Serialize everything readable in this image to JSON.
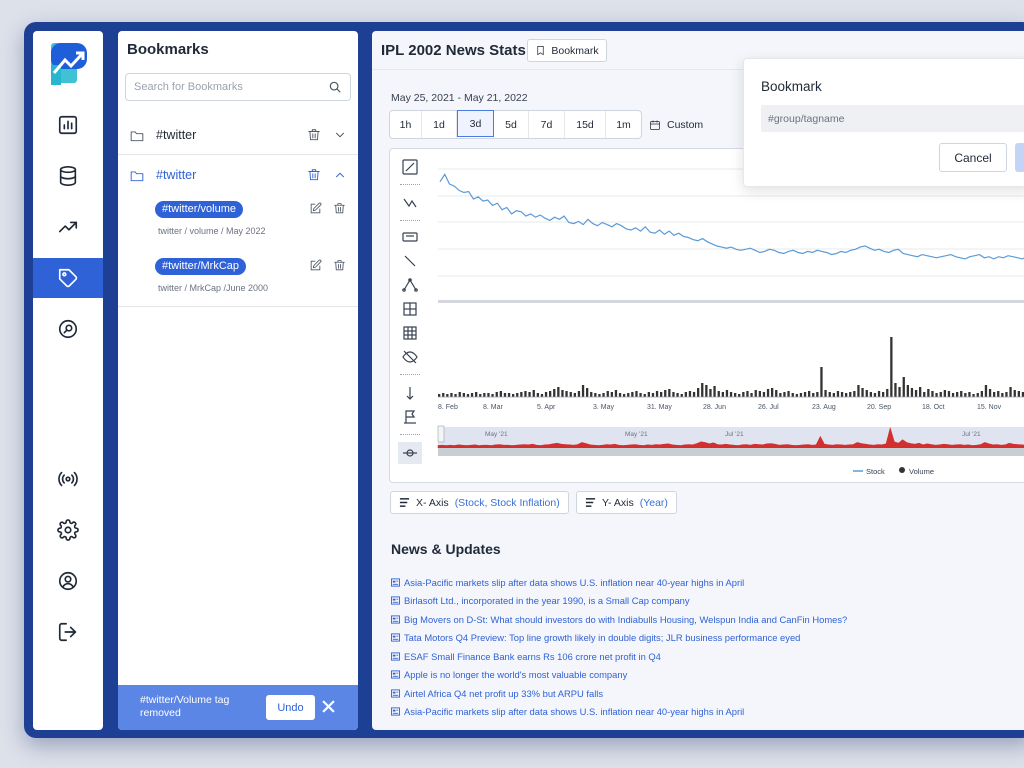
{
  "sidebar_nav": [
    "analytics",
    "database",
    "trending",
    "tags",
    "search",
    "broadcast",
    "settings",
    "profile",
    "logout"
  ],
  "bookmarks": {
    "title": "Bookmarks",
    "search_placeholder": "Search for Bookmarks",
    "groups": [
      {
        "label": "#twitter",
        "expanded": false
      },
      {
        "label": "#twitter",
        "expanded": true,
        "tags": [
          {
            "label": "#twitter/volume",
            "path": "twitter / volume / May 2022"
          },
          {
            "label": "#twitter/MrkCap",
            "path": "twitter / MrkCap /June 2000"
          }
        ]
      }
    ],
    "toast": {
      "message": "#twitter/Volume tag removed",
      "undo_label": "Undo"
    }
  },
  "main": {
    "title": "IPL 2002 News Stats",
    "bookmark_button": "Bookmark",
    "date_range": "May 25, 2021 - May 21, 2022",
    "ranges": [
      "1h",
      "1d",
      "3d",
      "5d",
      "7d",
      "15d",
      "1m"
    ],
    "selected_range": "3d",
    "custom_label": "Custom",
    "x_axis": {
      "label": "X- Axis",
      "value": "(Stock, Stock Inflation)"
    },
    "y_axis": {
      "label": "Y- Axis",
      "value": "(Year)"
    }
  },
  "chart_data": {
    "type": "line",
    "x_ticks": [
      "8. Feb",
      "8. Mar",
      "5. Apr",
      "3. May",
      "31. May",
      "28. Jun",
      "26. Jul",
      "23. Aug",
      "20. Sep",
      "18. Oct",
      "15. Nov"
    ],
    "navigator_ticks": [
      "May '21",
      "May '21",
      "Jul '21",
      "Jul '21"
    ],
    "legend": [
      "Stock",
      "Volume"
    ],
    "colors": {
      "stock": "#5b9bd5",
      "volume": "#333333",
      "navigator": "#d32f2f"
    },
    "stock": [
      88,
      95,
      86,
      84,
      80,
      78,
      79,
      72,
      74,
      70,
      71,
      66,
      68,
      62,
      64,
      58,
      61,
      60,
      56,
      58,
      55,
      57,
      54,
      52,
      55,
      53,
      56,
      50,
      49,
      51,
      48,
      53,
      49,
      47,
      50,
      48,
      46,
      49,
      47,
      44,
      43,
      45,
      42,
      46,
      41,
      40,
      43,
      39,
      42,
      38,
      40,
      37,
      36,
      34,
      33,
      35,
      32,
      30,
      28,
      27,
      26,
      27,
      25,
      24,
      25,
      26,
      24,
      22,
      23,
      25,
      24,
      22,
      21,
      23,
      24,
      22,
      21,
      23,
      22,
      24,
      23,
      22,
      20,
      21,
      23,
      22,
      24,
      25,
      27,
      28,
      26,
      24,
      25,
      23,
      22,
      24,
      25,
      21,
      20,
      19,
      18,
      20,
      19,
      18,
      17,
      18,
      19,
      20,
      18,
      17,
      16,
      18,
      19,
      20,
      17,
      18,
      16,
      18,
      17,
      19,
      18,
      17,
      16,
      18,
      17
    ],
    "volume": [
      3,
      4,
      3,
      4,
      3,
      5,
      4,
      3,
      4,
      5,
      3,
      4,
      4,
      3,
      5,
      6,
      4,
      4,
      3,
      4,
      5,
      6,
      5,
      7,
      4,
      3,
      5,
      6,
      8,
      10,
      7,
      6,
      5,
      4,
      6,
      12,
      9,
      5,
      4,
      3,
      4,
      6,
      5,
      7,
      4,
      3,
      4,
      5,
      6,
      4,
      3,
      5,
      4,
      6,
      5,
      7,
      8,
      5,
      4,
      3,
      5,
      6,
      5,
      9,
      14,
      12,
      8,
      11,
      6,
      5,
      7,
      5,
      4,
      3,
      5,
      6,
      4,
      7,
      6,
      5,
      8,
      9,
      7,
      4,
      5,
      6,
      4,
      3,
      4,
      5,
      6,
      4,
      5,
      30,
      7,
      5,
      4,
      6,
      5,
      4,
      5,
      6,
      12,
      9,
      7,
      5,
      4,
      6,
      5,
      8,
      60,
      14,
      10,
      20,
      12,
      9,
      7,
      10,
      5,
      8,
      6,
      4,
      5,
      7,
      6,
      4,
      5,
      6,
      4,
      5,
      3,
      4,
      6,
      12,
      8,
      5,
      6,
      4,
      5,
      10,
      7,
      6,
      5,
      4
    ]
  },
  "news": {
    "title": "News & Updates",
    "items": [
      "Asia-Pacific markets slip after data shows U.S. inflation near 40-year highs in April",
      "Birlasoft Ltd., incorporated in the year 1990, is a Small Cap company",
      "Big Movers on D-St: What should investors do with Indiabulls Housing, Welspun India and CanFin Homes?",
      "Tata Motors Q4 Preview: Top line growth likely in double digits; JLR business performance eyed",
      "ESAF Small Finance Bank earns Rs 106 crore net profit in Q4",
      "Apple is no longer the world's most valuable company",
      "Airtel Africa Q4 net profit up 33% but ARPU falls",
      "Asia-Pacific markets slip after data shows U.S. inflation near 40-year highs in April"
    ]
  },
  "popup": {
    "title": "Bookmark",
    "input_placeholder": "#group/tagname",
    "cancel_label": "Cancel"
  }
}
